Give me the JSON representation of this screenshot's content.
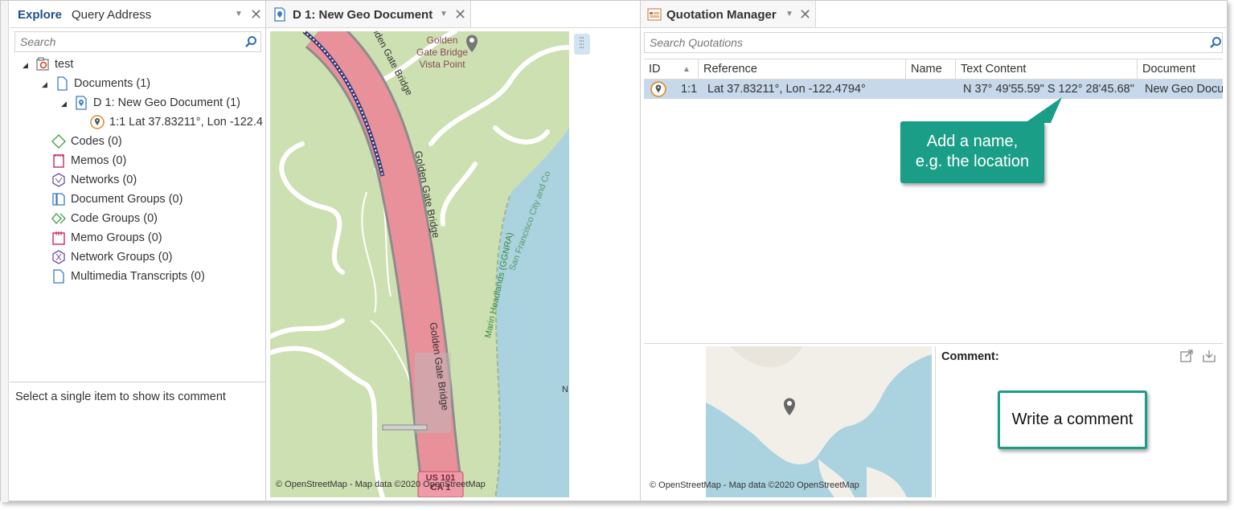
{
  "explore": {
    "tabs": [
      {
        "label": "Explore",
        "active": true
      },
      {
        "label": "Query Address",
        "active": false
      }
    ],
    "search_placeholder": "Search",
    "tree": {
      "project": "test",
      "documents": "Documents (1)",
      "document": "D 1: New Geo Document (1)",
      "quotation": "1:1 Lat 37.83211°, Lon -122.4",
      "codes": "Codes (0)",
      "memos": "Memos (0)",
      "networks": "Networks (0)",
      "document_groups": "Document Groups (0)",
      "code_groups": "Code Groups (0)",
      "memo_groups": "Memo Groups (0)",
      "network_groups": "Network Groups (0)",
      "multimedia": "Multimedia Transcripts (0)"
    },
    "comment_hint": "Select a single item to show its comment"
  },
  "geodoc": {
    "tab_label": "D 1: New Geo Document",
    "map_labels": {
      "poi": [
        "Golden",
        "Gate Bridge",
        "Vista Point"
      ],
      "road1": "Golden Gate Bridge",
      "road2": "Golden Gate Bridge",
      "road3": "Golden Gate Bridge",
      "road_top": "lden Gate Bridge",
      "headlands": "Marin Headlands (GGNRA)",
      "sf": "San Francisco City and Co",
      "shield1": "US 101",
      "shield2": "CA 1",
      "edge_n": "N"
    },
    "attribution": "© OpenStreetMap - Map data ©2020 OpenStreetMap"
  },
  "quotation_manager": {
    "title": "Quotation Manager",
    "search_placeholder": "Search Quotations",
    "columns": [
      "ID",
      "Reference",
      "Name",
      "Text Content",
      "Document"
    ],
    "rows": [
      {
        "id": "1:1",
        "reference": "Lat 37.83211°, Lon -122.4794°",
        "name": "",
        "text_content": "N 37° 49'55.59\" S 122° 28'45.68\"",
        "document": "New Geo Docu"
      }
    ],
    "callout_name": [
      "Add a name,",
      "e.g. the location"
    ],
    "comment_label": "Comment:",
    "callout_comment": "Write a comment",
    "attribution": "© OpenStreetMap - Map data ©2020 OpenStreetMap"
  },
  "colors": {
    "accent": "#1b9e87",
    "selection": "#c6d8ea",
    "road": "#e8919b",
    "park": "#cde0b2",
    "water": "#aad3df"
  }
}
